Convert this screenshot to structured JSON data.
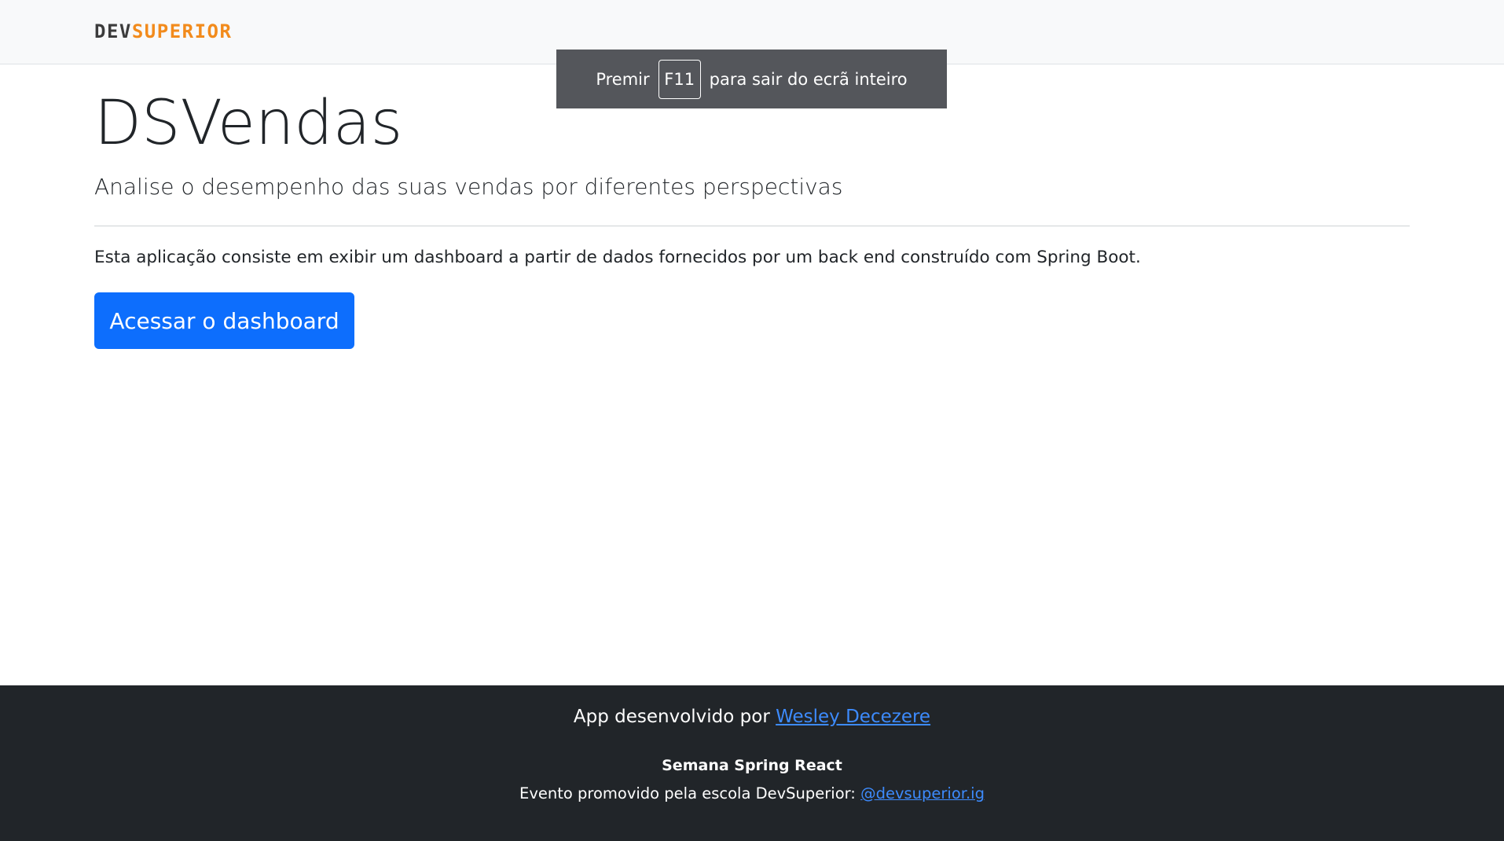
{
  "navbar": {
    "logo_part1": "DEV",
    "logo_part2": "SUPERIOR"
  },
  "fullscreen_toast": {
    "prefix": "Premir",
    "key": "F11",
    "suffix": "para sair do ecrã inteiro"
  },
  "main": {
    "title": "DSVendas",
    "subtitle": "Analise o desempenho das suas vendas por diferentes perspectivas",
    "description": "Esta aplicação consiste em exibir um dashboard a partir de dados fornecidos por um back end construído com Spring Boot.",
    "button_label": "Acessar o dashboard"
  },
  "footer": {
    "credit_text": "App desenvolvido por ",
    "credit_link": "Wesley Decezere",
    "event_title": "Semana Spring React",
    "event_text": "Evento promovido pela escola DevSuperior: ",
    "event_link": "@devsuperior.ig"
  },
  "colors": {
    "primary": "#0d6efd",
    "brand_orange": "#f28b1c",
    "footer_bg": "#212529",
    "navbar_bg": "#f8f9fa"
  }
}
